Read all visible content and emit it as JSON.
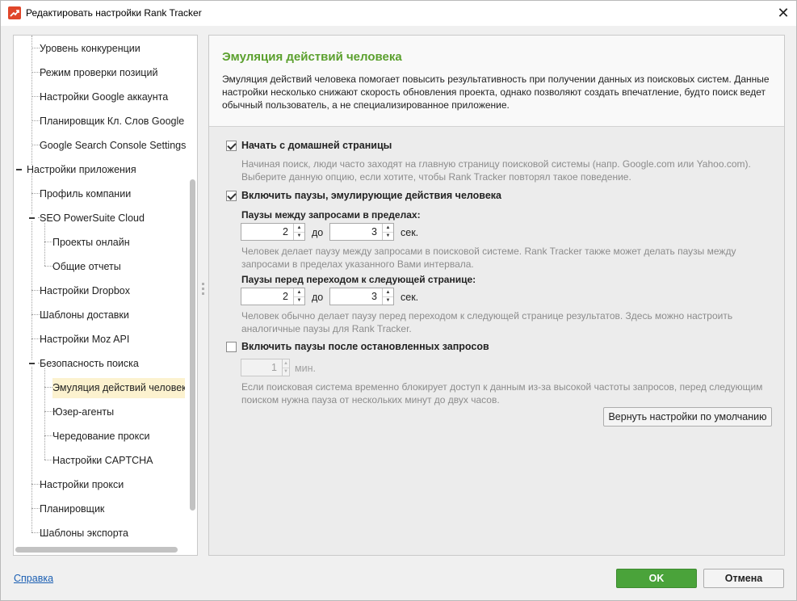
{
  "window": {
    "title": "Редактировать настройки Rank Tracker",
    "close_glyph": "✕"
  },
  "sidebar": {
    "items": [
      {
        "label": "Уровень конкуренции"
      },
      {
        "label": "Режим проверки позиций"
      },
      {
        "label": "Настройки Google аккаунта"
      },
      {
        "label": "Планировщик Кл. Слов Google"
      },
      {
        "label": "Google Search Console Settings"
      },
      {
        "label": "Настройки приложения"
      },
      {
        "label": "Профиль компании"
      },
      {
        "label": "SEO PowerSuite Cloud"
      },
      {
        "label": "Проекты онлайн"
      },
      {
        "label": "Общие отчеты"
      },
      {
        "label": "Настройки Dropbox"
      },
      {
        "label": "Шаблоны доставки"
      },
      {
        "label": "Настройки Moz API"
      },
      {
        "label": "Безопасность поиска"
      },
      {
        "label": "Эмуляция действий человека"
      },
      {
        "label": "Юзер-агенты"
      },
      {
        "label": "Чередование прокси"
      },
      {
        "label": "Настройки CAPTCHA"
      },
      {
        "label": "Настройки прокси"
      },
      {
        "label": "Планировщик"
      },
      {
        "label": "Шаблоны экспорта"
      }
    ],
    "selected": "Эмуляция действий человека"
  },
  "main": {
    "title": "Эмуляция действий человека",
    "description": "Эмуляция действий человека помогает повысить результативность при получении данных из поисковых систем. Данные настройки несколько снижают скорость обновления проекта, однако позволяют создать впечатление, будто поиск ведет обычный пользователь, а не специализированное приложение.",
    "start_home": {
      "label": "Начать с домашней страницы",
      "checked": true,
      "hint": "Начиная поиск, люди часто заходят на главную страницу поисковой системы (напр. Google.com или Yahoo.com). Выберите данную опцию, если хотите, чтобы Rank Tracker повторял такое поведение."
    },
    "pauses": {
      "label": "Включить паузы, эмулирующие действия человека",
      "checked": true,
      "between_requests": {
        "label": "Паузы между запросами в пределах:",
        "from": "2",
        "to_word": "до",
        "to": "3",
        "unit": "сек.",
        "hint": "Человек делает паузу между запросами в поисковой системе. Rank Tracker также может делать паузы между запросами в пределах указанного Вами интервала."
      },
      "before_next_page": {
        "label": "Паузы перед переходом к следующей странице:",
        "from": "2",
        "to_word": "до",
        "to": "3",
        "unit": "сек.",
        "hint": "Человек обычно делает паузу перед переходом к следующей странице результатов. Здесь можно настроить аналогичные паузы для Rank Tracker."
      }
    },
    "stopped_pauses": {
      "label": "Включить паузы после остановленных запросов",
      "checked": false,
      "value": "1",
      "unit": "мин.",
      "hint": "Если поисковая система временно блокирует доступ к данным из-за высокой частоты запросов, перед следующим поиском нужна пауза от нескольких минут до двух часов."
    },
    "reset_label": "Вернуть настройки по умолчанию"
  },
  "footer": {
    "help_label": "Справка",
    "ok_label": "OK",
    "cancel_label": "Отмена"
  },
  "colors": {
    "accent_green": "#5ba02e",
    "ok_button": "#4aa33a",
    "selection": "#fcf2cf",
    "link": "#1b5fb3"
  }
}
